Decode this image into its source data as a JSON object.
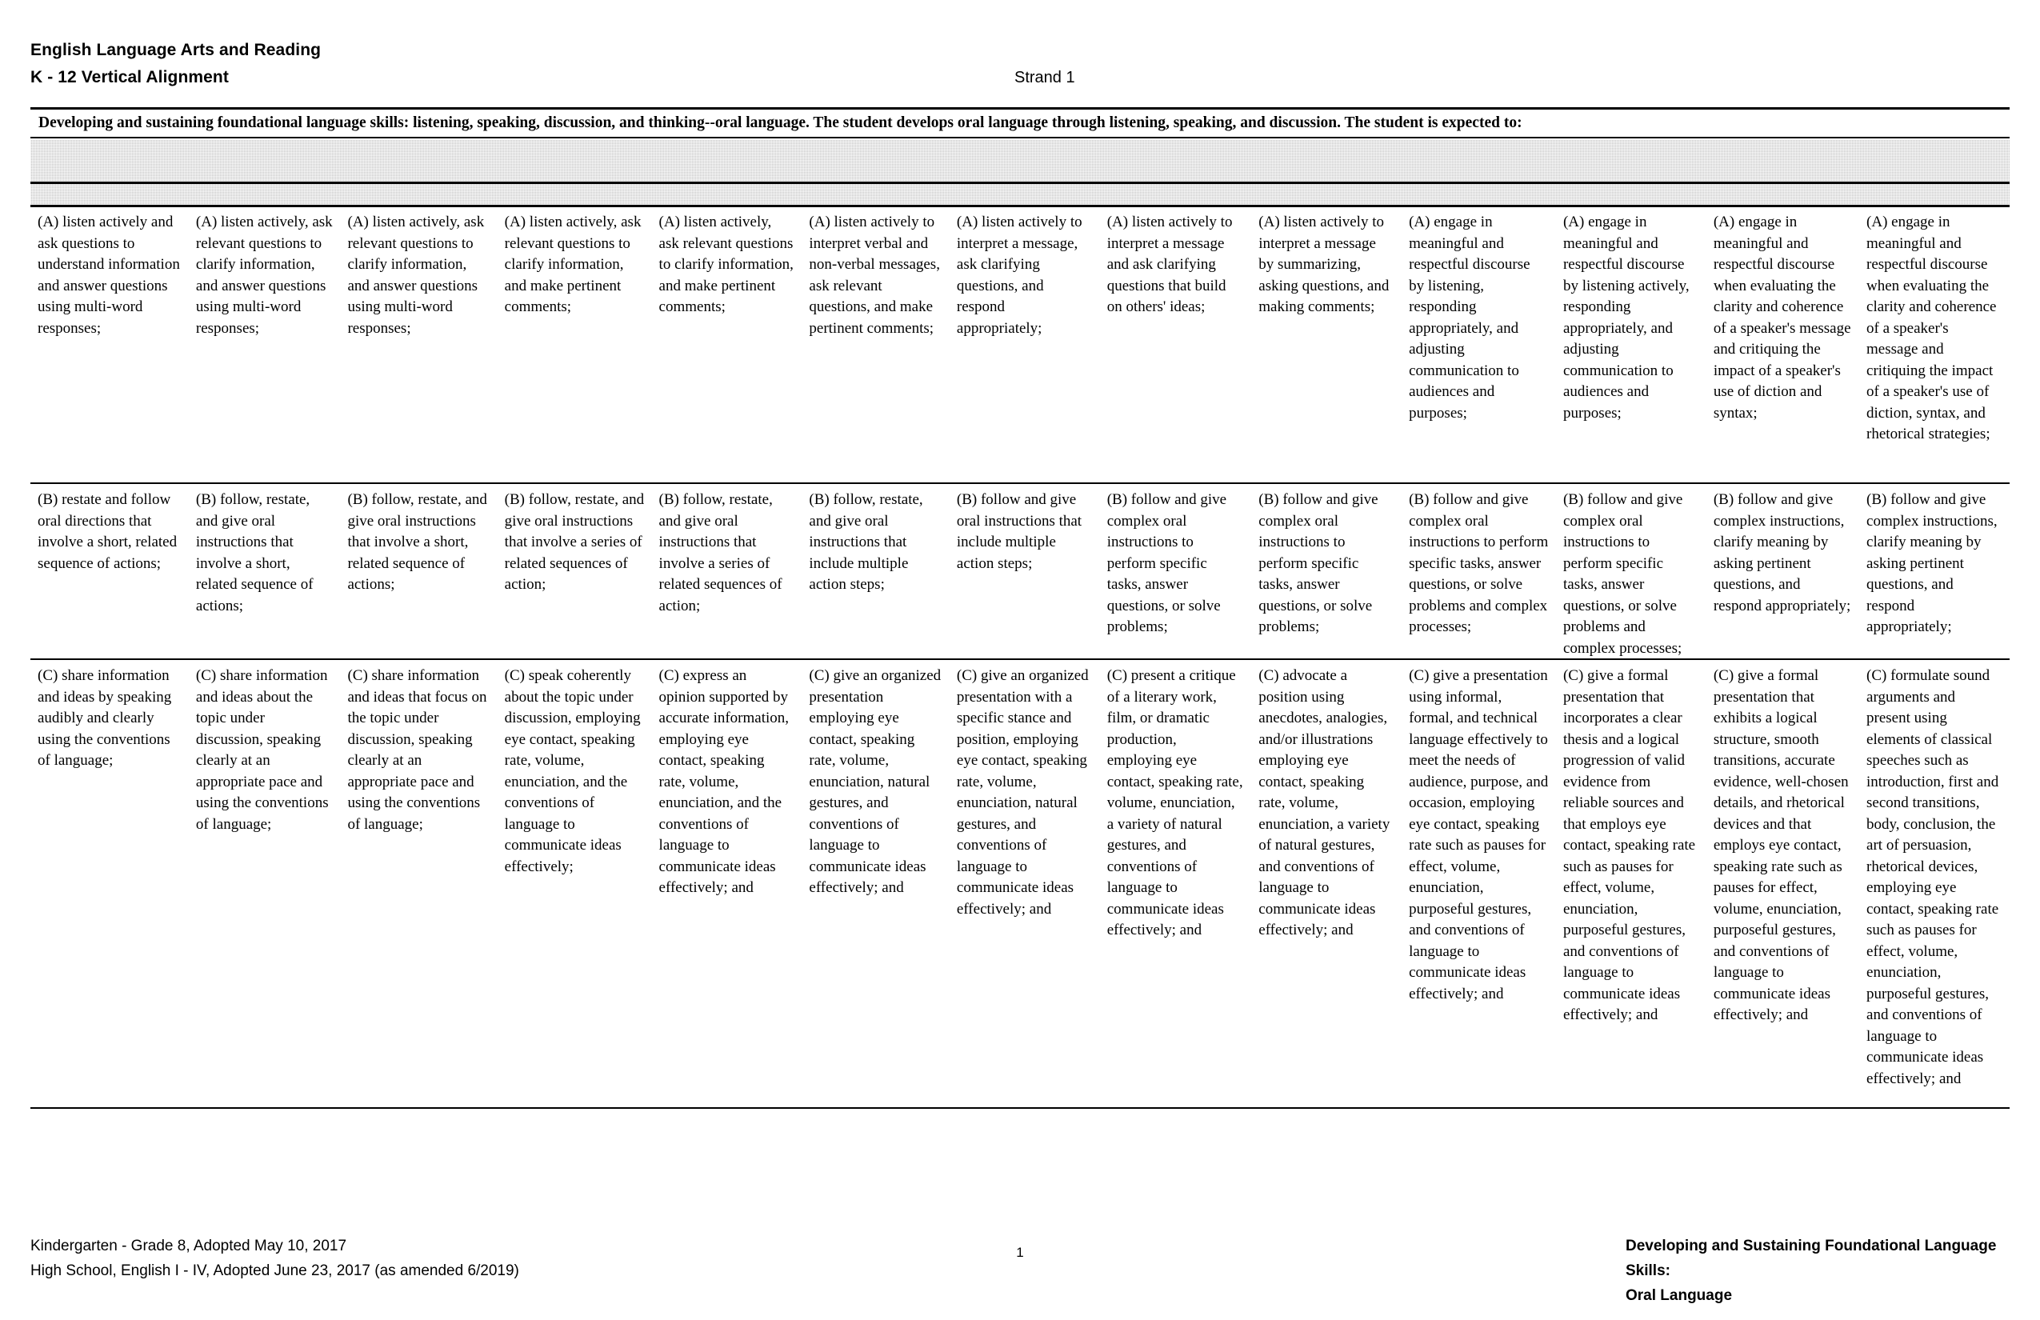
{
  "header": {
    "title_line1": "English Language Arts and Reading",
    "title_line2": "K - 12 Vertical Alignment",
    "strand_label": "Strand 1"
  },
  "strand": {
    "description": "Developing and sustaining foundational language skills: listening, speaking, discussion, and thinking--oral language. The student develops oral language through listening, speaking, and discussion. The student is expected to:"
  },
  "table": {
    "column_count": 14,
    "rows": [
      {
        "key": "A",
        "cells": [
          "(A) listen actively and ask questions to understand information and answer questions using multi-word responses;",
          "(A) listen actively, ask relevant questions to clarify information, and answer questions using multi-word responses;",
          "(A) listen actively, ask relevant questions to clarify information, and answer questions using multi-word responses;",
          "(A) listen actively, ask relevant questions to clarify information, and make pertinent comments;",
          "(A) listen actively, ask relevant questions to clarify information, and make pertinent comments;",
          "(A) listen actively to interpret verbal and non-verbal messages, ask relevant questions, and make pertinent comments;",
          "(A) listen actively to interpret a message, ask clarifying questions, and respond appropriately;",
          "(A) listen actively to interpret a message and ask clarifying questions that build on others' ideas;",
          "(A) listen actively to interpret a message by summarizing, asking questions, and making comments;",
          "(A) engage in meaningful and respectful discourse by listening, responding appropriately, and adjusting communication to audiences and purposes;",
          "(A) engage in meaningful and respectful discourse by listening actively, responding appropriately, and adjusting communication to audiences and purposes;",
          "(A) engage in meaningful and respectful discourse when evaluating the clarity and coherence of a speaker's message and critiquing the impact of a speaker's use of diction and syntax;",
          "(A) engage in meaningful and respectful discourse when evaluating the clarity and coherence of a speaker's message and critiquing the impact of a speaker's use of diction, syntax, and rhetorical strategies;"
        ]
      },
      {
        "key": "B",
        "cells": [
          "(B) restate and follow oral directions that involve a short, related sequence of actions;",
          "(B) follow, restate, and give oral instructions that involve a short, related sequence of actions;",
          "(B) follow, restate, and give oral instructions that involve a short, related sequence of actions;",
          "(B) follow, restate, and give oral instructions that involve a series of related sequences of action;",
          "(B) follow, restate, and give oral instructions that involve a series of related sequences of action;",
          "(B) follow, restate, and give oral instructions that include multiple action steps;",
          "(B) follow and give oral instructions that include multiple action steps;",
          "(B) follow and give complex oral instructions to perform specific tasks, answer questions, or solve problems;",
          "(B) follow and give complex oral instructions to perform specific tasks, answer questions, or solve problems;",
          "(B) follow and give complex oral instructions to perform specific tasks, answer questions, or solve problems and complex processes;",
          "(B) follow and give complex oral instructions to perform specific tasks, answer questions, or solve problems and complex processes;",
          "(B) follow and give complex instructions, clarify meaning by asking pertinent questions, and respond appropriately;",
          "(B) follow and give complex instructions, clarify meaning by asking pertinent questions, and respond appropriately;"
        ]
      },
      {
        "key": "C",
        "cells": [
          "(C) share information and ideas by speaking audibly and clearly using the conventions of language;",
          "(C) share information and ideas about the topic under discussion, speaking clearly at an appropriate pace and using the conventions of language;",
          "(C) share information and ideas that focus on the topic under discussion, speaking clearly at an appropriate pace and using the conventions of language;",
          "(C) speak coherently about the topic under discussion, employing eye contact, speaking rate, volume, enunciation, and the conventions of language to communicate ideas effectively;",
          "(C) express an opinion supported by accurate information, employing eye contact, speaking rate, volume, enunciation, and the conventions of language to communicate ideas effectively; and",
          "(C) give an organized presentation employing eye contact, speaking rate, volume, enunciation, natural gestures, and conventions of language to communicate ideas effectively; and",
          "(C) give an organized presentation with a specific stance and position, employing eye contact, speaking rate, volume, enunciation, natural gestures, and conventions of language to communicate ideas effectively; and",
          "(C) present a critique of a literary work, film, or dramatic production, employing eye contact, speaking rate, volume, enunciation, a variety of natural gestures, and conventions of language to communicate ideas effectively; and",
          "(C) advocate a position using anecdotes, analogies, and/or illustrations employing eye contact, speaking rate, volume, enunciation, a variety of natural gestures, and conventions of language to communicate ideas effectively; and",
          "(C) give a presentation using informal, formal, and technical language effectively to meet the needs of audience, purpose, and occasion, employing eye contact, speaking rate such as pauses for effect, volume, enunciation, purposeful gestures, and conventions of language to communicate ideas effectively; and",
          "(C) give a formal presentation that incorporates a clear thesis and a logical progression of valid evidence from reliable sources and that employs eye contact, speaking rate such as pauses for effect, volume, enunciation, purposeful gestures, and conventions of language to communicate ideas effectively; and",
          "(C) give a formal presentation that exhibits a logical structure, smooth transitions, accurate evidence, well-chosen details, and rhetorical devices and that employs eye contact, speaking rate such as pauses for effect, volume, enunciation, purposeful gestures, and conventions of language to communicate ideas effectively; and",
          "(C) formulate sound arguments and present using elements of classical speeches such as introduction, first and second transitions, body, conclusion, the art of persuasion, rhetorical devices, employing eye contact, speaking rate such as pauses for effect, volume, enunciation, purposeful gestures, and conventions of language to communicate ideas effectively; and"
        ]
      }
    ]
  },
  "footer": {
    "left_line1": "Kindergarten - Grade 8, Adopted May 10, 2017",
    "left_line2": "High School, English I - IV, Adopted June 23, 2017    (as amended 6/2019)",
    "page_number": "1",
    "right_line1": "Developing and Sustaining Foundational Language Skills:",
    "right_line2": "Oral Language"
  }
}
